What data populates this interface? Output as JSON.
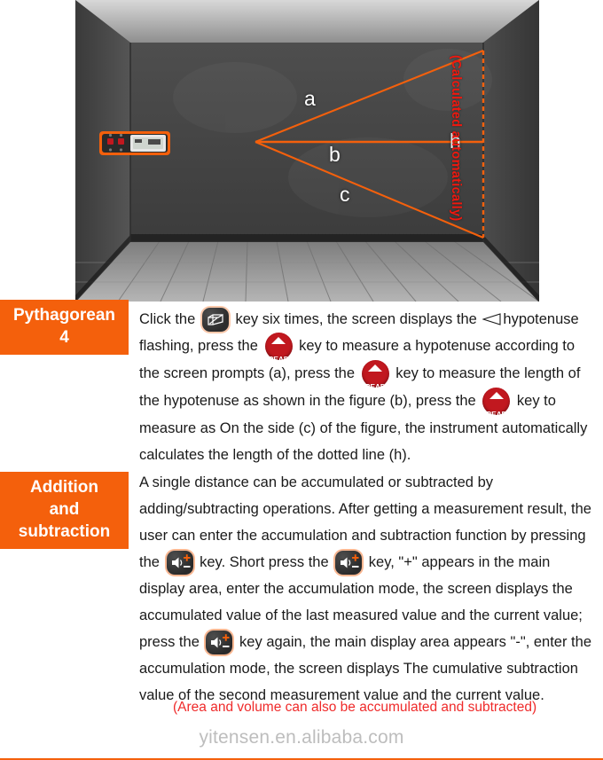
{
  "diagram": {
    "labels": {
      "a": "a",
      "b": "b",
      "c": "c",
      "h": "h"
    },
    "annotation": "(Calculated automatically)",
    "device_name": "laser-distance-meter",
    "colors": {
      "laser_line": "#f4600c",
      "annotation": "#f0180f",
      "wall": "#4a4a4a",
      "floor": "#9a9a9a"
    }
  },
  "sections": [
    {
      "chip_label": "Pythagorean\n4",
      "chip_line1": "Pythagorean",
      "chip_line2": "4",
      "paragraph": {
        "p1": "Click the ",
        "p2": " key six times, the screen displays the ",
        "p3": "hypotenuse flashing, press the ",
        "p4": " key to measure a hypotenuse according to the screen prompts (a), press the ",
        "p5": " key to measure the length of the hypotenuse as shown in the figure (b), press the ",
        "p6": " key to measure as On the side (c) of the figure, the instrument automatically calculates the length of the dotted line (h)."
      }
    },
    {
      "chip_label": "Addition and subtraction",
      "chip_line1": "Addition",
      "chip_line2": "and",
      "chip_line3": "subtraction",
      "paragraph": {
        "p1": "A single distance can be accumulated or subtracted by adding/subtracting operations. After getting a measurement result, the user can enter the accumulation and subtraction function by pressing the ",
        "p2": " key. Short press the ",
        "p3": " key, \"+\" appears in the main display area, enter the accumulation mode, the screen displays the accumulated value of the last measured value and the current value; press the ",
        "p4": " key again, the main display area appears \"-\", enter the accumulation mode, the screen displays The cumulative subtraction value of the second measurement value and the current value."
      }
    }
  ],
  "red_note": "(Area and volume can also be accumulated and subtracted)",
  "watermark": "yitensen.en.alibaba.com",
  "icons": {
    "volume_key": "volume-box-key-icon",
    "read_key": "read-key-icon",
    "read_key_text": "READ",
    "plus_minus_key": "plus-minus-key-icon",
    "hypotenuse_glyph": "hypotenuse-triangle-icon"
  },
  "theme": {
    "accent_orange": "#f4600c",
    "read_red": "#c1181f",
    "note_red": "#ef2a2a",
    "watermark_gray": "#bdbdbd"
  }
}
